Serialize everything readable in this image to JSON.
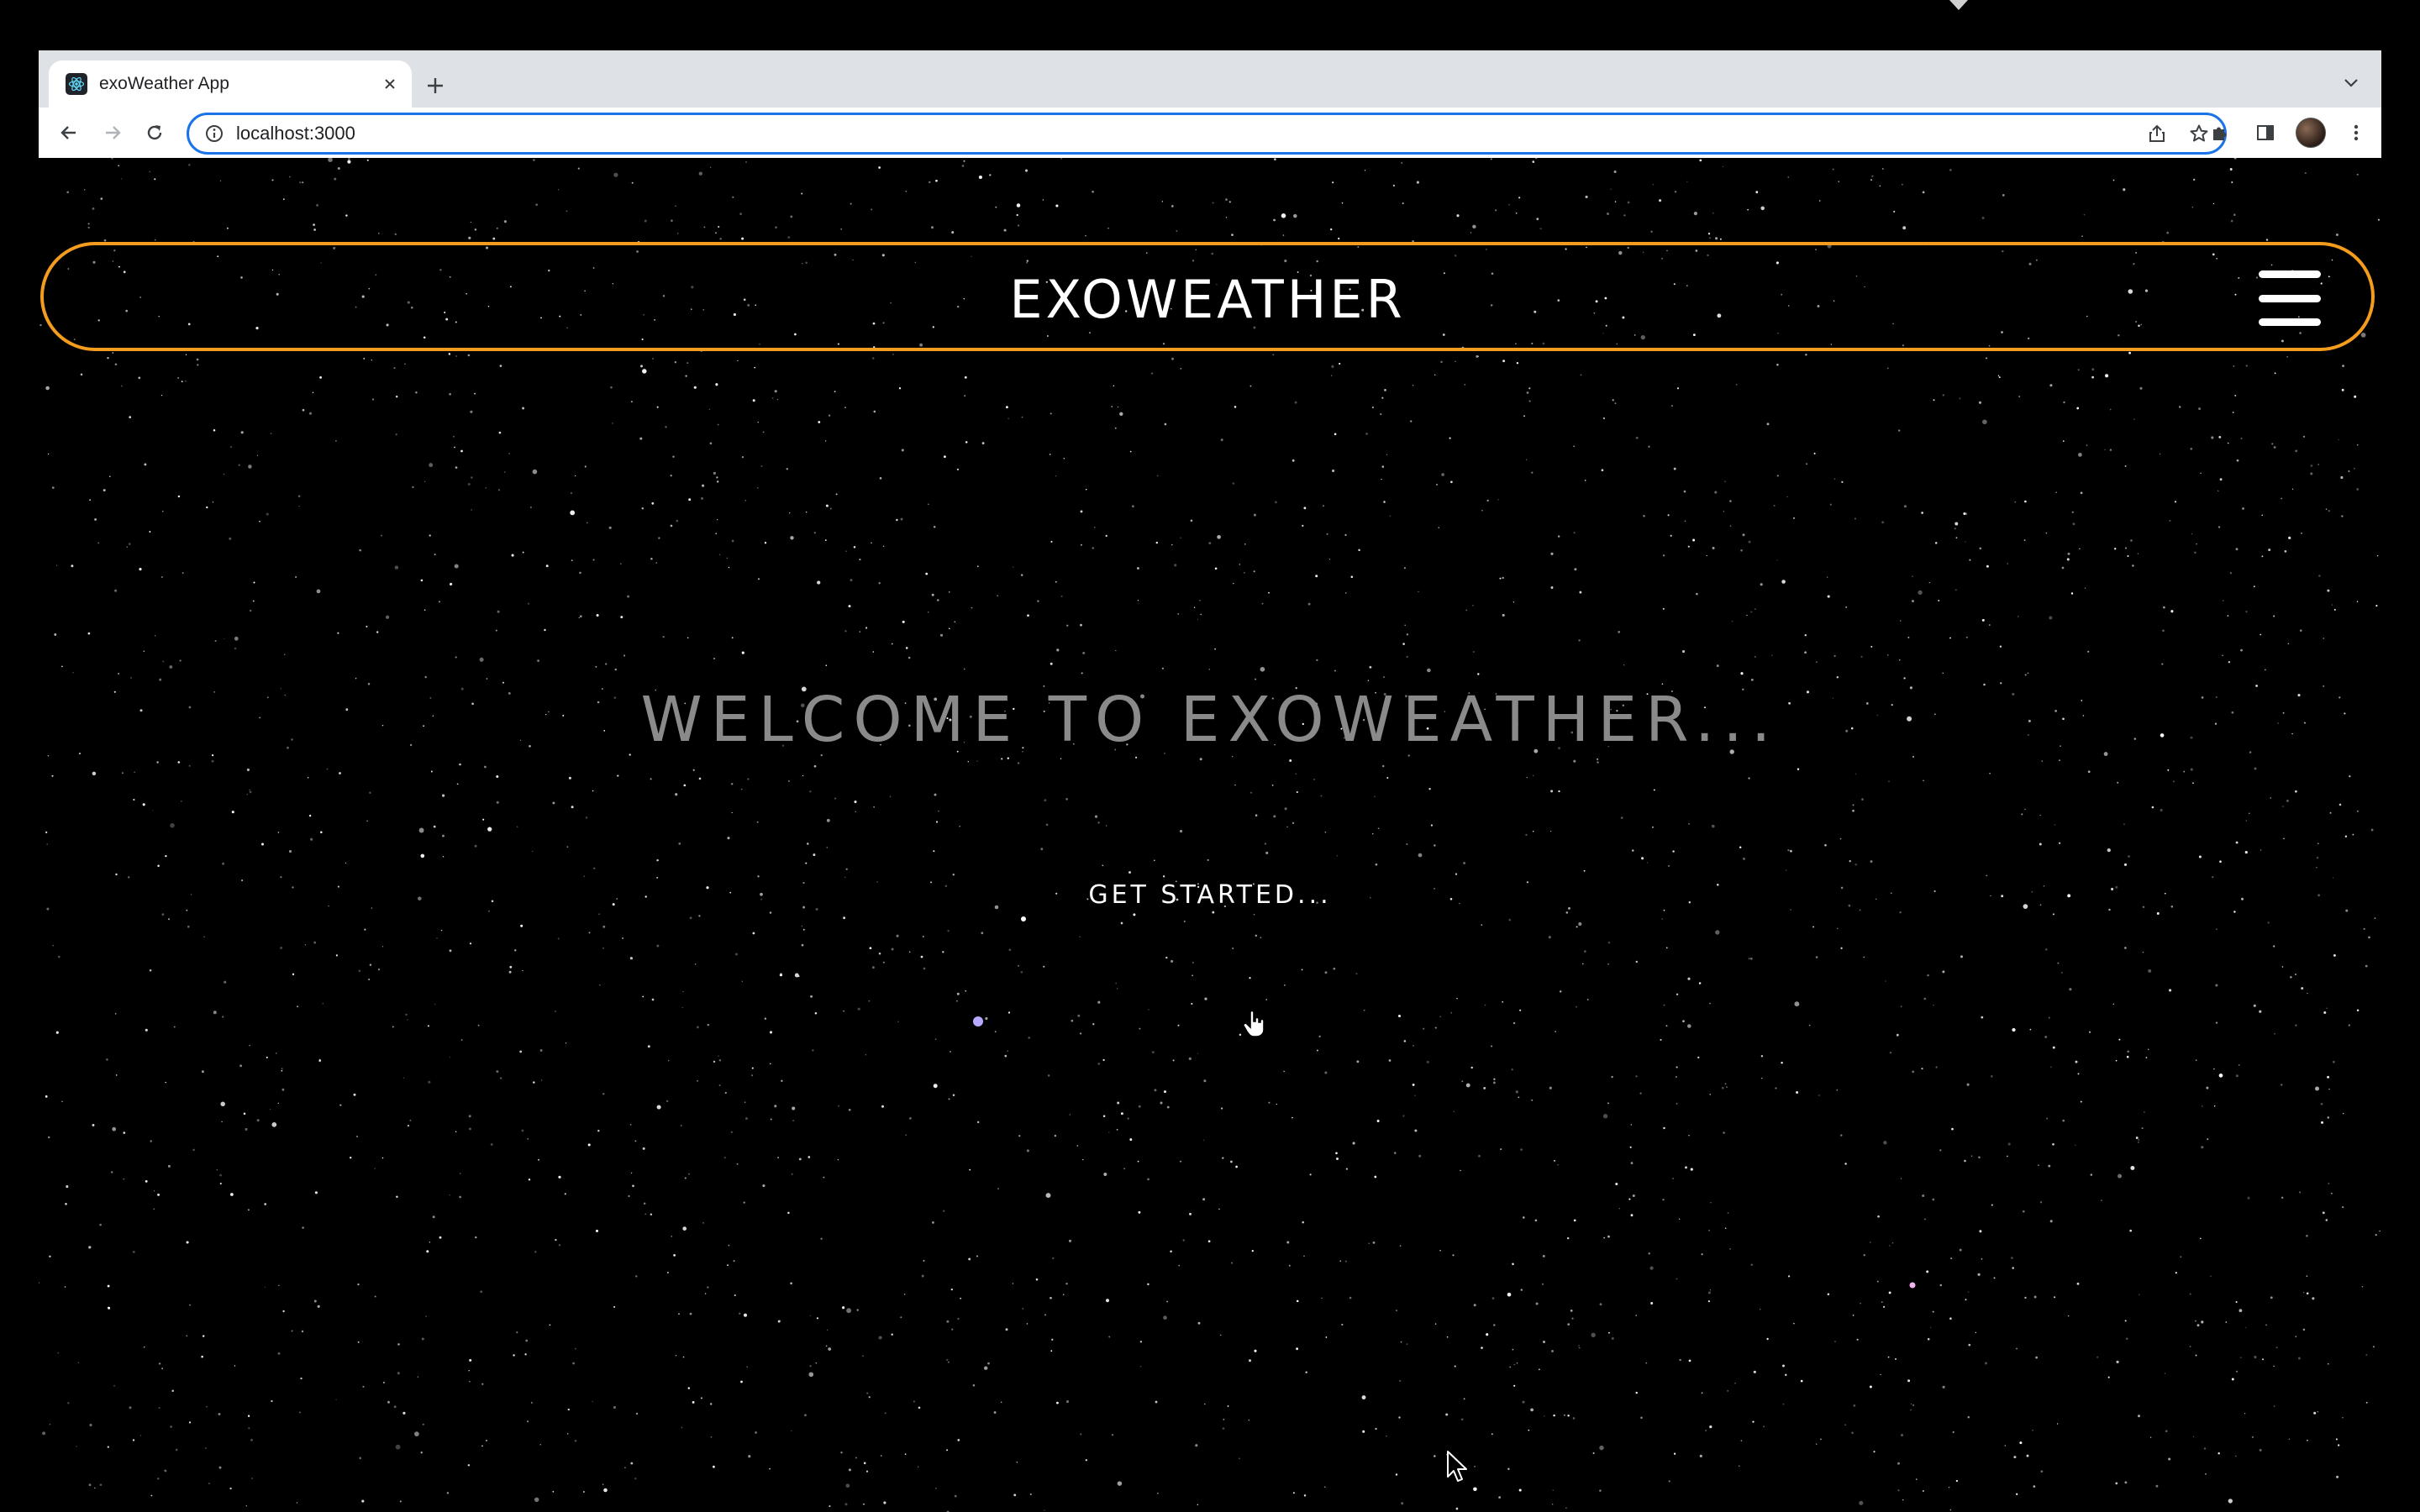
{
  "browser": {
    "tab": {
      "title": "exoWeather App"
    },
    "address_bar": {
      "url": "localhost:3000"
    }
  },
  "app": {
    "brand": "EXOWEATHER",
    "welcome_heading": "WELCOME TO EXOWEATHER...",
    "cta_label": "GET STARTED..."
  },
  "colors": {
    "background": "#000000",
    "navbar_border": "#f39c1e",
    "heading_text": "#8a8a8a",
    "text": "#ffffff",
    "address_bar_focus": "#1a73e8"
  }
}
